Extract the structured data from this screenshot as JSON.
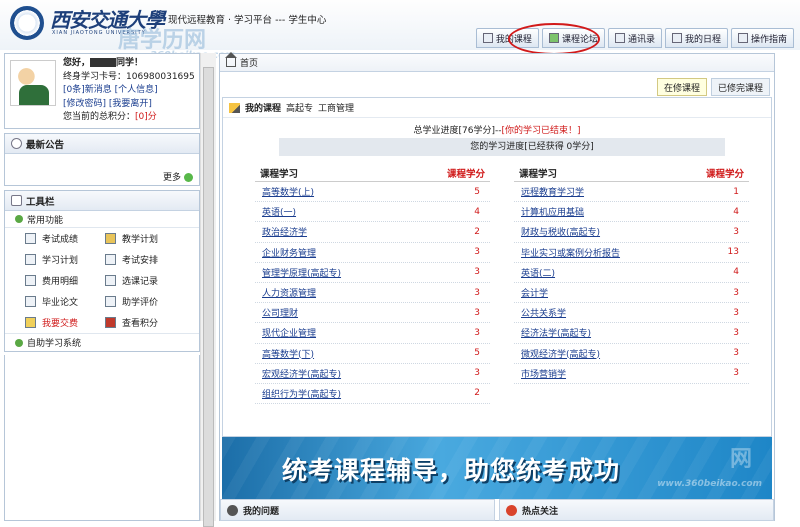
{
  "header": {
    "university_cn": "西安交通大學",
    "university_en": "XIAN JIAOTONG UNIVERSITY",
    "system_title": "现代远程教育 · 学习平台 --- 学生中心",
    "watermark_top": "唐学历网",
    "watermark_top_url": "360beikao.com",
    "tabs": [
      {
        "label": "我的课程",
        "icon": "home-icon"
      },
      {
        "label": "课程论坛",
        "icon": "forum-icon"
      },
      {
        "label": "通讯录",
        "icon": "contacts-icon"
      },
      {
        "label": "我的日程",
        "icon": "calendar-icon"
      },
      {
        "label": "操作指南",
        "icon": "guide-icon"
      }
    ]
  },
  "profile": {
    "greeting": "您好，",
    "greeting_suffix": "同学！",
    "card_label": "终身学习卡号：",
    "card_number": "106980031695",
    "messages": "[0条]新消息",
    "personal_info": "[个人信息]",
    "change_password": "[修改密码]",
    "leave": "[我要离开]",
    "score_label": "您当前的总积分：",
    "score_value": "[0]分"
  },
  "announcements": {
    "title": "最新公告",
    "more": "更多"
  },
  "toolbar": {
    "title": "工具栏",
    "common_title": "常用功能",
    "tools": [
      {
        "label": "考试成绩",
        "icon": "grades-icon",
        "highlight": false
      },
      {
        "label": "教学计划",
        "icon": "key-icon",
        "highlight": false
      },
      {
        "label": "学习计划",
        "icon": "study-plan-icon",
        "highlight": false
      },
      {
        "label": "考试安排",
        "icon": "exam-schedule-icon",
        "highlight": false
      },
      {
        "label": "费用明细",
        "icon": "fees-icon",
        "highlight": false
      },
      {
        "label": "选课记录",
        "icon": "course-record-icon",
        "highlight": false
      },
      {
        "label": "毕业论文",
        "icon": "thesis-icon",
        "highlight": false
      },
      {
        "label": "助学评价",
        "icon": "evaluation-icon",
        "highlight": false
      },
      {
        "label": "我要交费",
        "icon": "pay-icon",
        "highlight": true
      },
      {
        "label": "查看积分",
        "icon": "points-icon",
        "highlight": false
      }
    ],
    "self_study": "自助学习系统"
  },
  "main": {
    "breadcrumb": "首页",
    "subtabs": [
      "在修课程",
      "已修完课程"
    ],
    "panel_title": "我的课程",
    "level": "高起专",
    "major": "工商管理",
    "total_progress_prefix": "总学业进度[76学分]--",
    "total_progress_status": "[你的学习已结束！]",
    "my_progress": "您的学习进度[已经获得 0学分]",
    "col_course": "课程学习",
    "col_credit": "课程学分",
    "left_courses": [
      {
        "name": "高等数学(上)",
        "credit": "5"
      },
      {
        "name": "英语(一)",
        "credit": "4"
      },
      {
        "name": "政治经济学",
        "credit": "2"
      },
      {
        "name": "企业财务管理",
        "credit": "3"
      },
      {
        "name": "管理学原理(高起专)",
        "credit": "3"
      },
      {
        "name": "人力资源管理",
        "credit": "3"
      },
      {
        "name": "公司理财",
        "credit": "3"
      },
      {
        "name": "现代企业管理",
        "credit": "3"
      },
      {
        "name": "高等数学(下)",
        "credit": "5"
      },
      {
        "name": "宏观经济学(高起专)",
        "credit": "3"
      },
      {
        "name": "组织行为学(高起专)",
        "credit": "2"
      }
    ],
    "right_courses": [
      {
        "name": "远程教育学习学",
        "credit": "1"
      },
      {
        "name": "计算机应用基础",
        "credit": "4"
      },
      {
        "name": "财政与税收(高起专)",
        "credit": "3"
      },
      {
        "name": "毕业实习或案例分析报告",
        "credit": "13"
      },
      {
        "name": "英语(二)",
        "credit": "4"
      },
      {
        "name": "会计学",
        "credit": "3"
      },
      {
        "name": "公共关系学",
        "credit": "3"
      },
      {
        "name": "经济法学(高起专)",
        "credit": "3"
      },
      {
        "name": "微观经济学(高起专)",
        "credit": "3"
      },
      {
        "name": "市场营销学",
        "credit": "3"
      }
    ],
    "banner_text": "统考课程辅导，助您统考成功",
    "banner_watermark": "网",
    "banner_watermark_url": "www.360beikao.com",
    "bottom": [
      "我的问题",
      "热点关注"
    ]
  }
}
